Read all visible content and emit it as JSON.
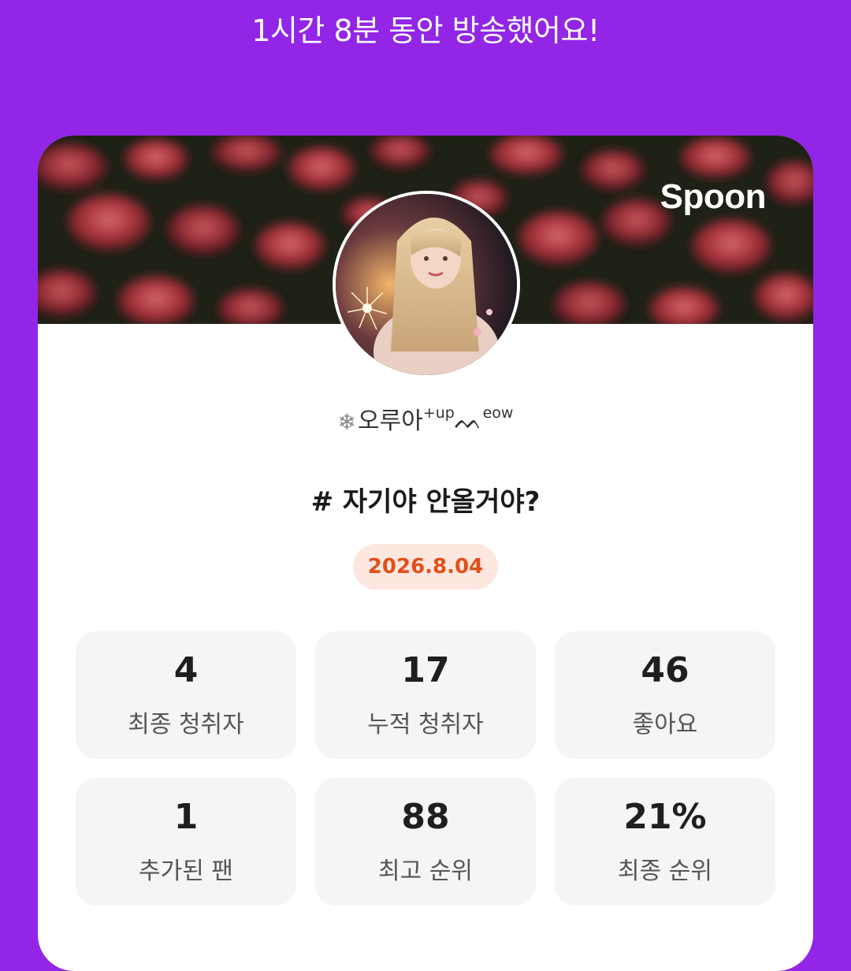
{
  "headline": "1시간 8분 동안 방송했어요!",
  "card": {
    "brand": "Spoon",
    "nickname": {
      "deco_icon": "snowflake-icon",
      "main": "오루아",
      "suffix_sup": "+up",
      "meow_prefix": "ᨓ",
      "meow_sup": "eow"
    },
    "title": "# 자기야 안올거야?",
    "date": "2026.8.04",
    "stats": [
      {
        "value": "4",
        "label": "최종 청취자"
      },
      {
        "value": "17",
        "label": "누적 청취자"
      },
      {
        "value": "46",
        "label": "좋아요"
      },
      {
        "value": "1",
        "label": "추가된 팬"
      },
      {
        "value": "88",
        "label": "최고 순위"
      },
      {
        "value": "21%",
        "label": "최종 순위"
      }
    ]
  },
  "colors": {
    "background": "#9225e6",
    "card": "#ffffff",
    "date_chip_bg": "#fde7df",
    "date_chip_text": "#e0501a",
    "stat_bg": "#f5f5f5"
  }
}
